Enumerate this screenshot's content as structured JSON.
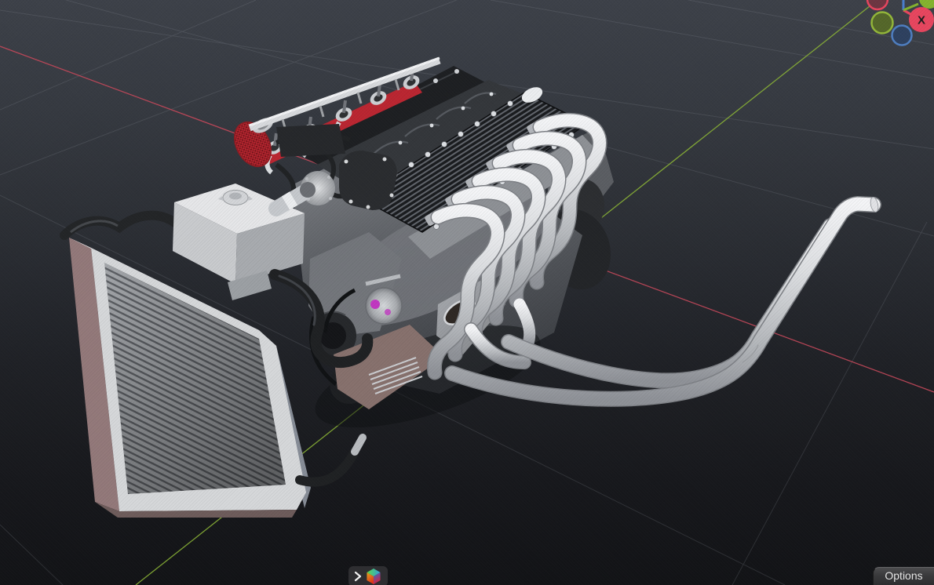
{
  "viewport": {
    "type": "3d-viewport",
    "content_description": "Inline-12 style engine model with radiator, coolant tank, red intake stacks and white exhaust headers, on a dark perspective grid floor",
    "background_top_color": "#3d4149",
    "background_bottom_color": "#121316",
    "grid_line_color": "#868b94",
    "x_axis_color": "#c4485a",
    "y_axis_color": "#8ab336"
  },
  "gizmo": {
    "x_label": "X",
    "x_ball_color": "#e8465f",
    "x_neg_fill": "#6e3642",
    "y_ball_color": "#85b42e",
    "y_neg_fill": "#55682a",
    "y_neg_ring": "#94b83a",
    "z_neg_fill": "#2e4160",
    "z_neg_ring": "#4f7fc2",
    "z_line_color": "#4a7fd0"
  },
  "model": {
    "intake_red": "#bb2631",
    "alternator_winding_color": "#c238c2",
    "radiator_side_color": "#93797a",
    "hose_black": "#202224",
    "cover_black": "#1d1f22",
    "pipe_white": "#e6e7ea",
    "oil_pan_mauve": "#87716d"
  },
  "shading_widget": {
    "expand_icon": "chevron-right",
    "shading_icon": "material-preview-cube"
  },
  "options_button": {
    "label": "Options"
  }
}
